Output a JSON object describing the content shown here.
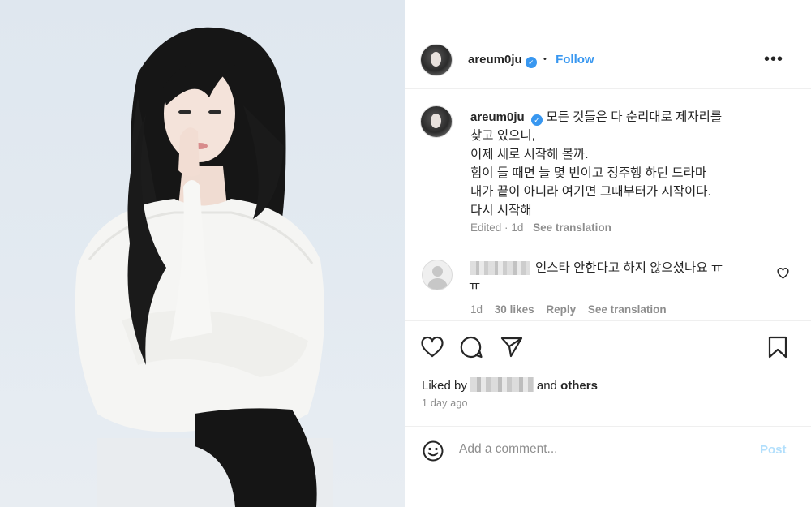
{
  "post": {
    "username": "areum0ju",
    "verified_glyph": "✓",
    "follow_label": "Follow",
    "separator": "•",
    "more_glyph": "•••",
    "photo_alt": "Profile photo"
  },
  "caption": {
    "username": "areum0ju",
    "lines": [
      "모든 것들은 다 순리대로 제자리를",
      "찾고 있으니,",
      "이제 새로 시작해 볼까.",
      "힘이 들 때면 늘 몇 번이고 정주행 하던 드라마",
      "내가 끝이 아니라 여기면 그때부터가 시작이다.",
      "다시 시작해"
    ],
    "edited": "Edited",
    "dot": "·",
    "age": "1d",
    "see_translation": "See translation"
  },
  "comment": {
    "text_line1": "인스타 안한다고 하지 않으셨나요 ㅠ",
    "text_line2": "ㅠ",
    "age": "1d",
    "likes": "30 likes",
    "reply": "Reply",
    "see_translation": "See translation",
    "like_icon": "heart-outline-icon"
  },
  "actions": {
    "like_icon": "heart-icon",
    "comment_icon": "comment-icon",
    "share_icon": "share-icon",
    "save_icon": "bookmark-icon",
    "liked_by_prefix": "Liked by",
    "liked_by_and": "and",
    "liked_by_others": "others",
    "time_ago": "1 day ago"
  },
  "composer": {
    "emoji_icon": "emoji-icon",
    "placeholder": "Add a comment...",
    "post_label": "Post",
    "post_color": "#b2dffc"
  },
  "colors": {
    "link_blue": "#3897f0",
    "muted_gray": "#8e8e8e",
    "text": "#262626"
  }
}
